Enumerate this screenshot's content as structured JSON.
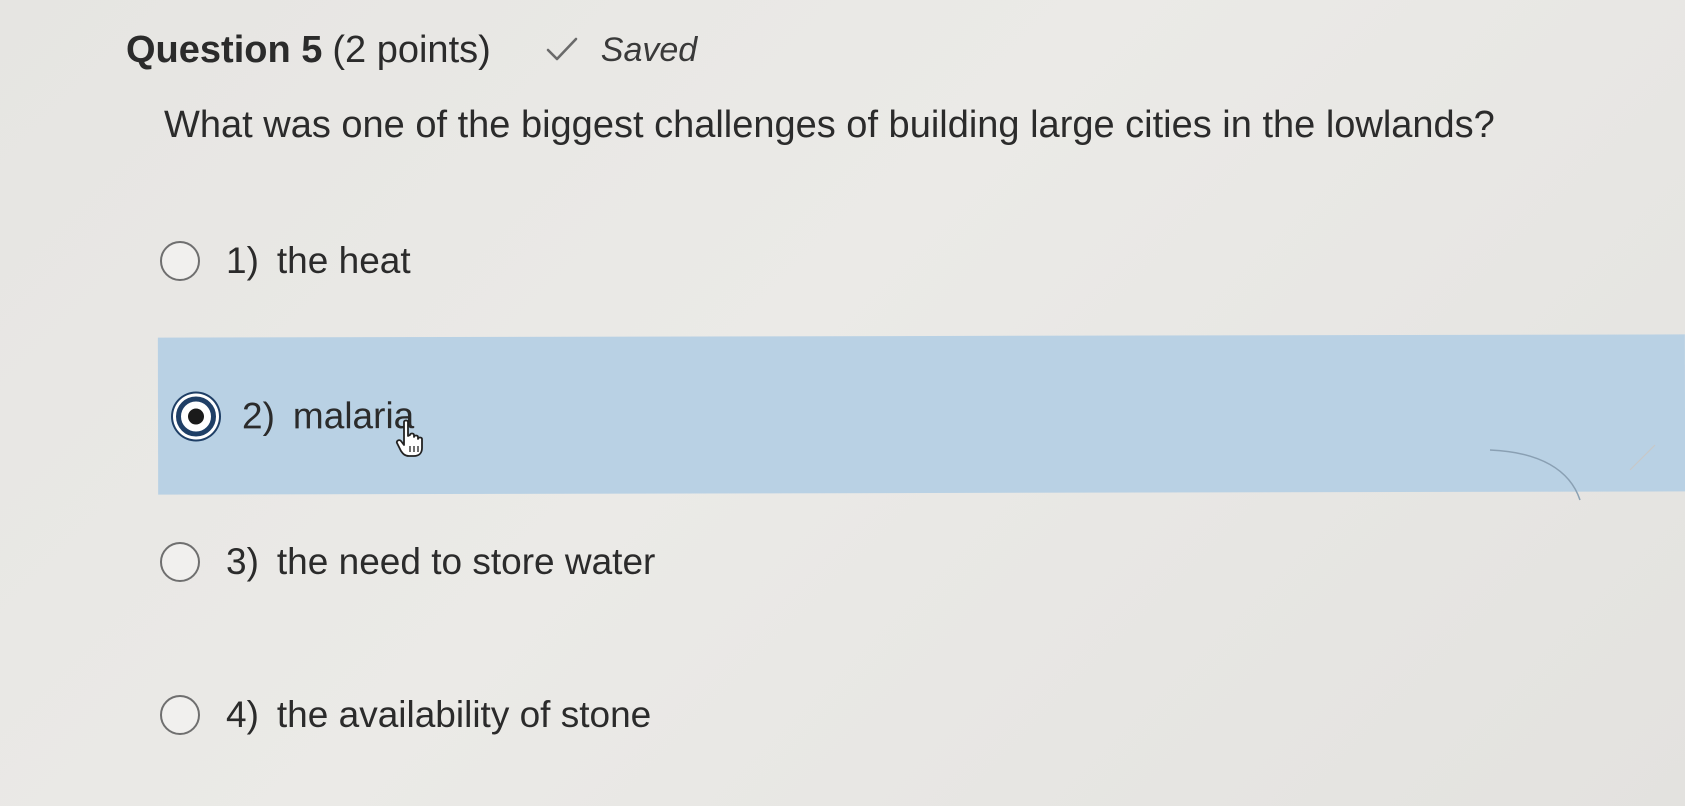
{
  "question": {
    "title": "Question 5",
    "points": "(2 points)",
    "saved_label": "Saved",
    "prompt": "What was one of the biggest challenges of building large cities in the lowlands?"
  },
  "options": [
    {
      "number": "1)",
      "label": "the heat",
      "selected": false
    },
    {
      "number": "2)",
      "label": "malaria",
      "selected": true
    },
    {
      "number": "3)",
      "label": "the need to store water",
      "selected": false
    },
    {
      "number": "4)",
      "label": "the availability of stone",
      "selected": false
    }
  ],
  "icons": {
    "saved": "checkmark-icon",
    "pointer": "hand-pointer-icon"
  },
  "colors": {
    "selected_background": "#b9d1e4",
    "radio_checked": "#1f3f66"
  }
}
